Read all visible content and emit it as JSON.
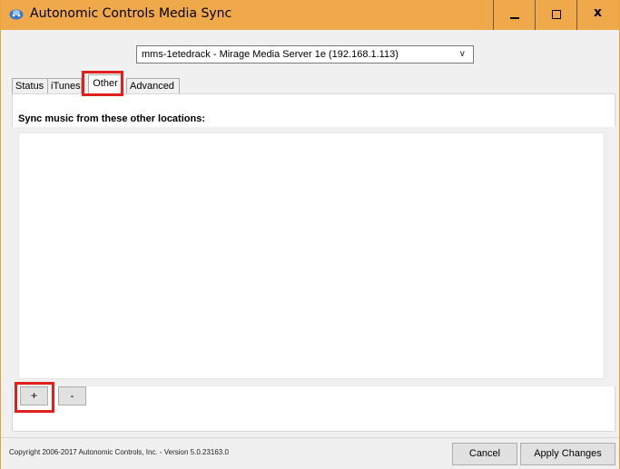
{
  "window": {
    "title": "Autonomic Controls Media Sync",
    "minimize_icon": "minimize-icon",
    "maximize_icon": "maximize-icon",
    "close_glyph": "x"
  },
  "server": {
    "selected": "mms-1etedrack - Mirage Media Server 1e (192.168.1.113)"
  },
  "tabs": [
    {
      "label": "Status",
      "selected": false
    },
    {
      "label": "iTunes",
      "selected": false
    },
    {
      "label": "Other",
      "selected": true
    },
    {
      "label": "Advanced",
      "selected": false
    }
  ],
  "other_tab": {
    "heading": "Sync music from these other locations:",
    "locations": [],
    "add_label": "+",
    "remove_label": "-"
  },
  "footer": {
    "copyright": "Copyright 2006-2017 Autonomic Controls, Inc. - Version 5.0.23163.0",
    "cancel_label": "Cancel",
    "apply_label": "Apply Changes"
  },
  "colors": {
    "titlebar": "#f0a94a",
    "highlight": "#e0201d"
  }
}
